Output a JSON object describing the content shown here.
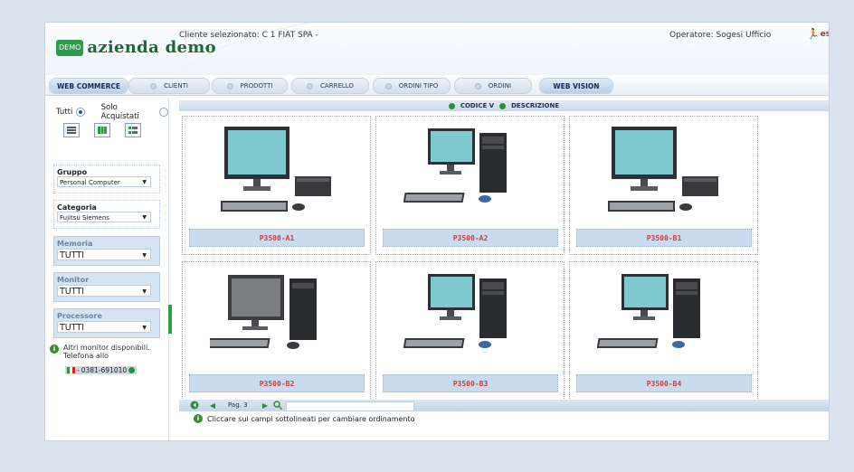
{
  "header": {
    "logo_badge": "DEMO",
    "logo_text": "azienda demo",
    "client_label": "Cliente selezionato: C 1 FIAT SPA -",
    "operator_label": "Operatore: Sogesi Ufficio",
    "exit_label": "esci"
  },
  "tabs": [
    {
      "label": "WEB COMMERCE"
    },
    {
      "label": "CLIENTI"
    },
    {
      "label": "PRODOTTI"
    },
    {
      "label": "CARRELLO"
    },
    {
      "label": "ORDINI TIPO"
    },
    {
      "label": "ORDINI"
    },
    {
      "label": "WEB VISION"
    }
  ],
  "sidebar": {
    "radio_all": "Tutti",
    "radio_bought": "Solo Acquistati",
    "filters": [
      {
        "label": "Gruppo",
        "value": "Personal Computer"
      },
      {
        "label": "Categoria",
        "value": "Fujitsu Siemens"
      },
      {
        "label": "Memoria",
        "value": "TUTTI"
      },
      {
        "label": "Monitor",
        "value": "TUTTI"
      },
      {
        "label": "Processore",
        "value": "TUTTI"
      }
    ],
    "info_text": "Altri monitor disponibili. Telefona allo",
    "phone": "0381-691010"
  },
  "sortbar": {
    "sort1": "CODICE V",
    "sort2": "DESCRIZIONE"
  },
  "products": [
    {
      "code": "P3500-A1"
    },
    {
      "code": "P3500-A2"
    },
    {
      "code": "P3500-B1"
    },
    {
      "code": "P3500-B2"
    },
    {
      "code": "P3500-B3"
    },
    {
      "code": "P3500-B4"
    }
  ],
  "pager": {
    "page_label": "Pag. 3"
  },
  "hint": "Cliccare sui campi sottolineati per cambiare ordinamento"
}
